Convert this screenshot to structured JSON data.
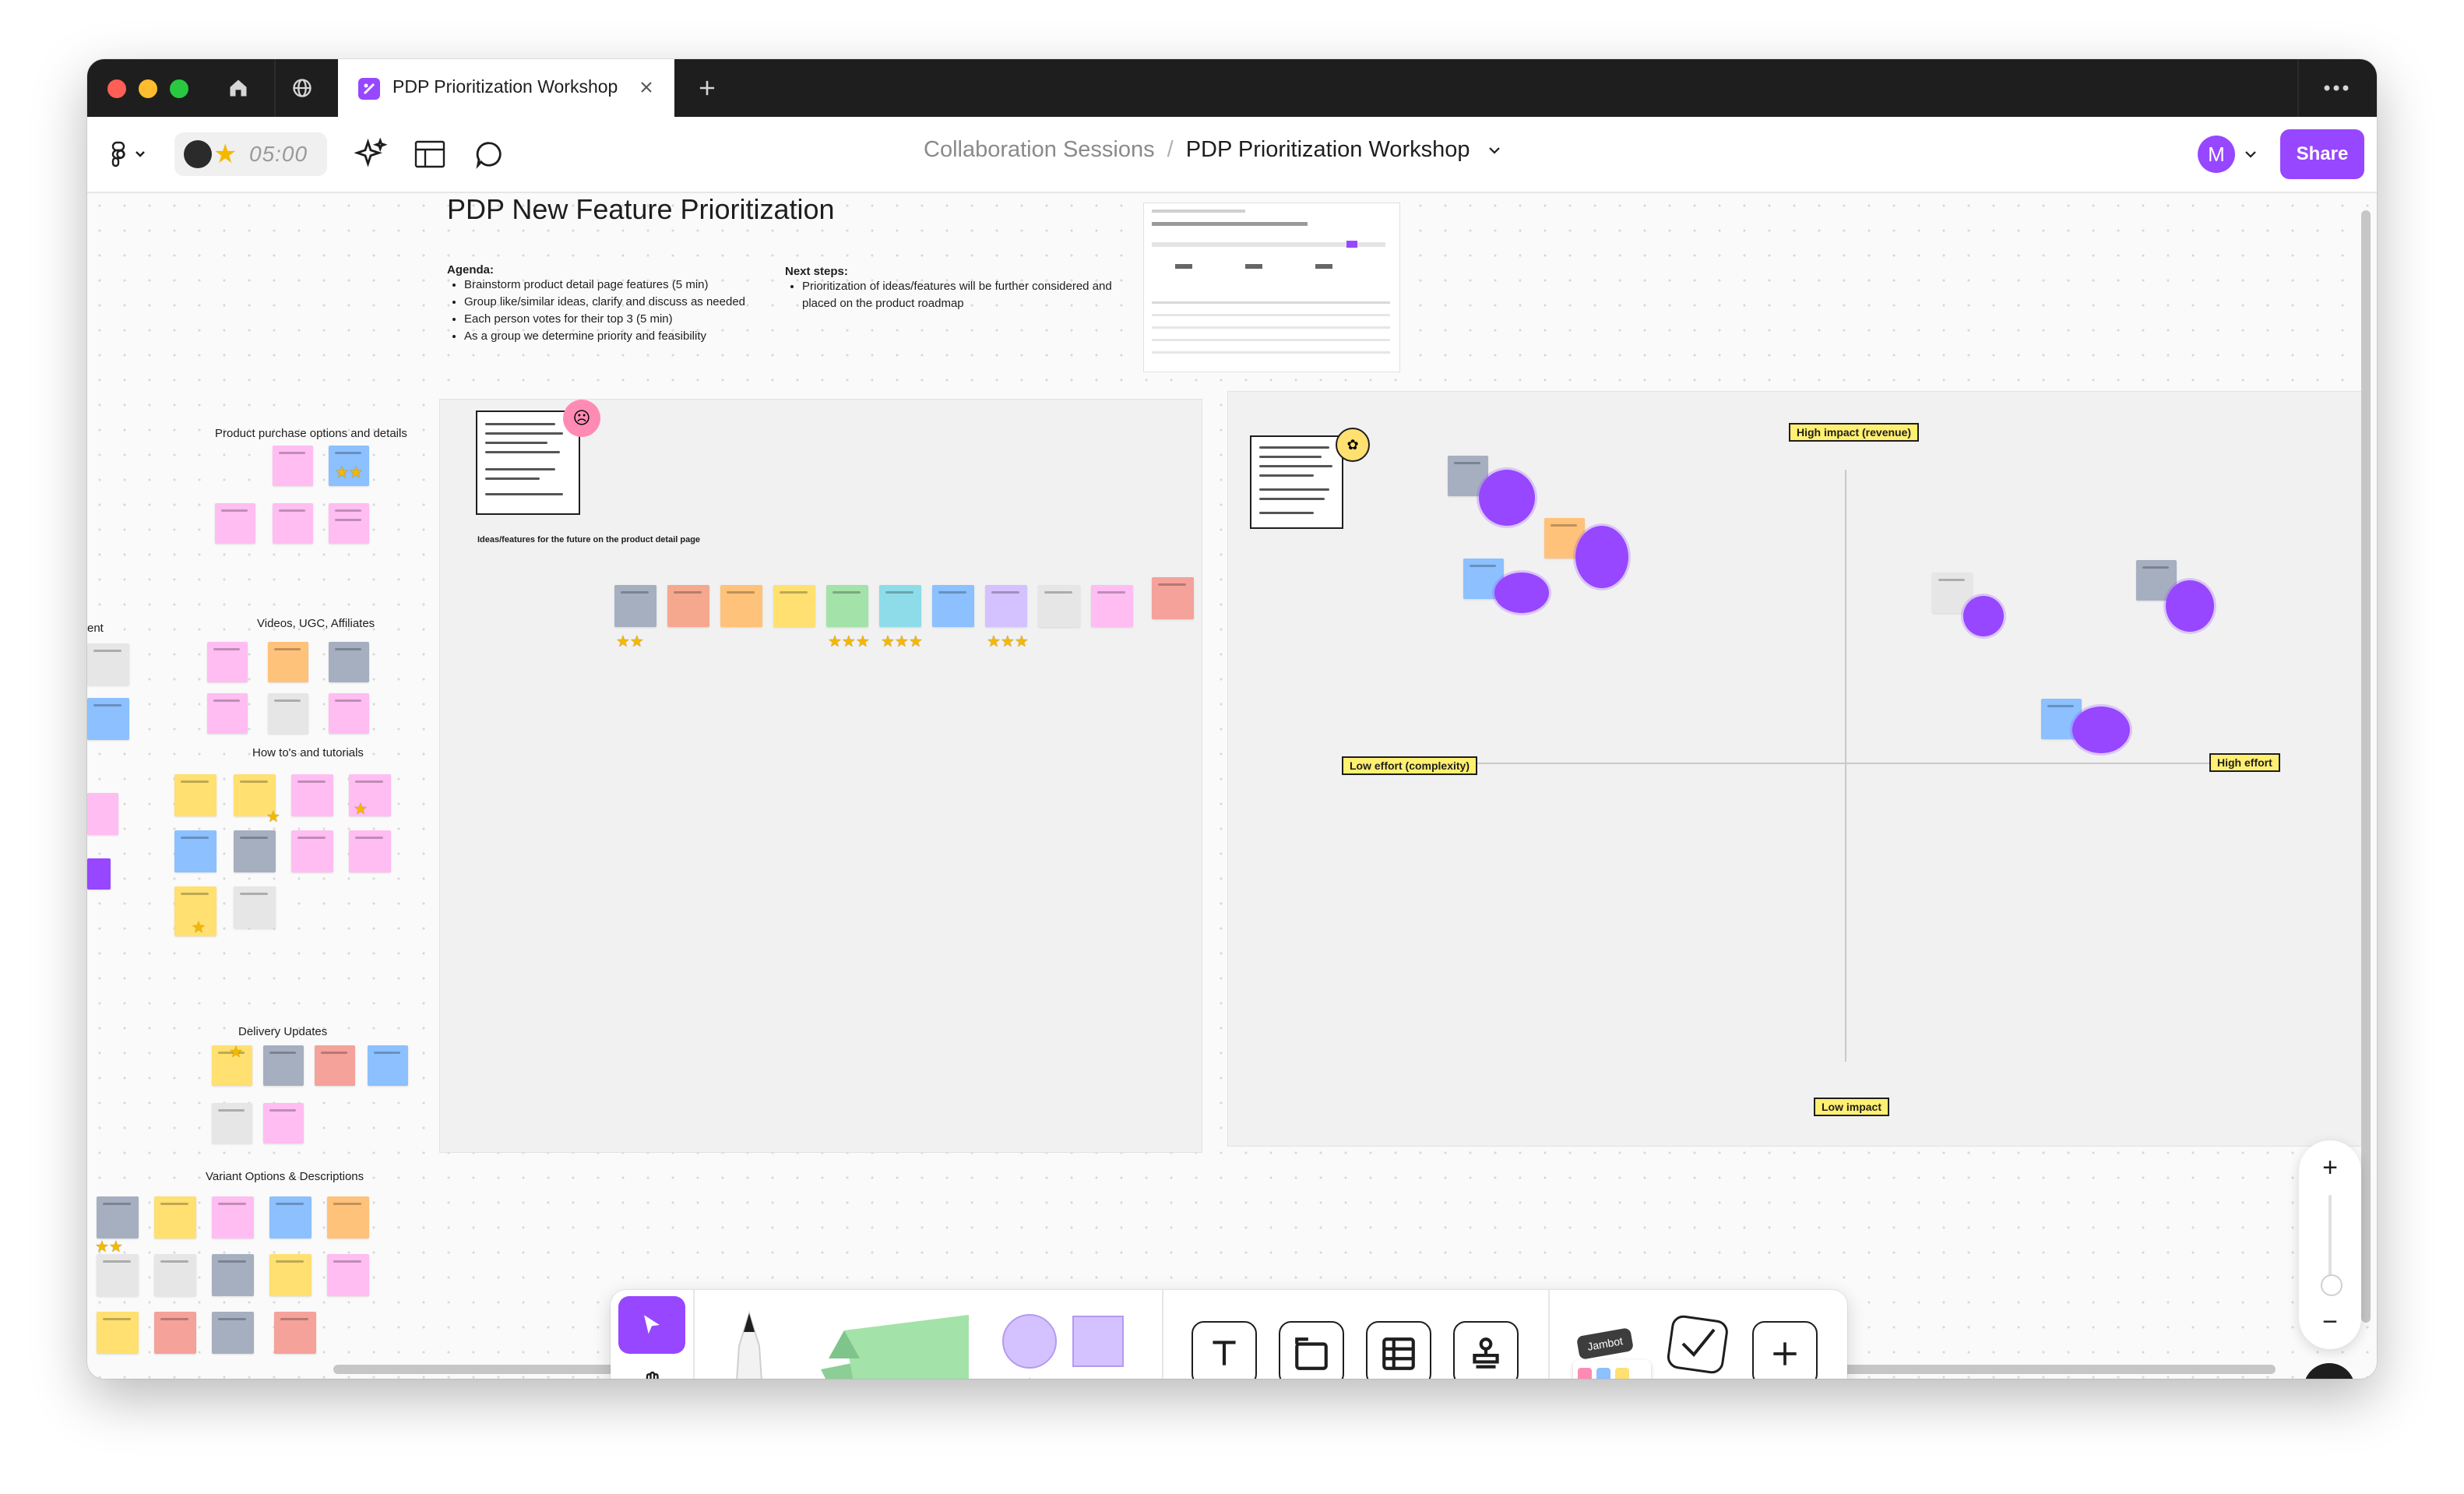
{
  "window": {
    "tab_title": "PDP Prioritization Workshop",
    "tab_icons": [
      "home-icon",
      "globe-icon",
      "figjam-file-icon",
      "close-icon",
      "plus-icon",
      "more-icon"
    ]
  },
  "toolbar": {
    "timer": "05:00",
    "breadcrumb": {
      "parent": "Collaboration Sessions",
      "separator": "/",
      "current": "PDP Prioritization Workshop"
    },
    "avatar_initial": "M",
    "share_label": "Share"
  },
  "board": {
    "title": "PDP New Feature Prioritization",
    "agenda_label": "Agenda:",
    "agenda_items": [
      "Brainstorm product detail page features (5 min)",
      "Group like/similar ideas, clarify and discuss as needed",
      "Each person votes for their top 3 (5 min)",
      "As a group we determine priority and feasibility"
    ],
    "next_steps_label": "Next steps:",
    "next_steps_items": [
      "Prioritization of ideas/features will be further considered and placed on the product roadmap"
    ],
    "ideas_section_label": "Ideas/features for the future on the product detail page",
    "clusters": [
      "Product purchase options and details",
      "Videos, UGC, Affiliates",
      "How to's and tutorials",
      "Delivery Updates",
      "Variant Options & Descriptions"
    ],
    "partial_left_label": "ent",
    "axis": {
      "top": "High impact (revenue)",
      "bottom": "Low impact",
      "left": "Low effort (complexity)",
      "right": "High effort"
    },
    "stickers": [
      "why-sticker",
      "lets-talk-sticker"
    ]
  },
  "colors": {
    "accent": "#9747ff",
    "sticky_gray": "#a6afc0",
    "sticky_orange": "#f5a88e",
    "sticky_peach": "#ffc27a",
    "sticky_yellow": "#ffe070",
    "sticky_green": "#a3e2a8",
    "sticky_teal": "#8edcea",
    "sticky_blue": "#8cc0ff",
    "sticky_purple": "#d4c1ff",
    "sticky_light_gray": "#e6e6e6",
    "sticky_pink": "#ffbdf2",
    "sticky_salmon": "#f4a29a"
  },
  "bottom_toolbar": {
    "tools": [
      "cursor-icon",
      "hand-icon",
      "marker-icon",
      "sticky-note-icon",
      "shapes-icon",
      "text-icon",
      "section-icon",
      "table-icon",
      "stamp-icon",
      "widgets-icon",
      "checklist-icon",
      "plus-icon"
    ],
    "jambot_label": "Jambot"
  },
  "zoom": {
    "plus": "+",
    "minus": "−"
  },
  "help_label": "?"
}
